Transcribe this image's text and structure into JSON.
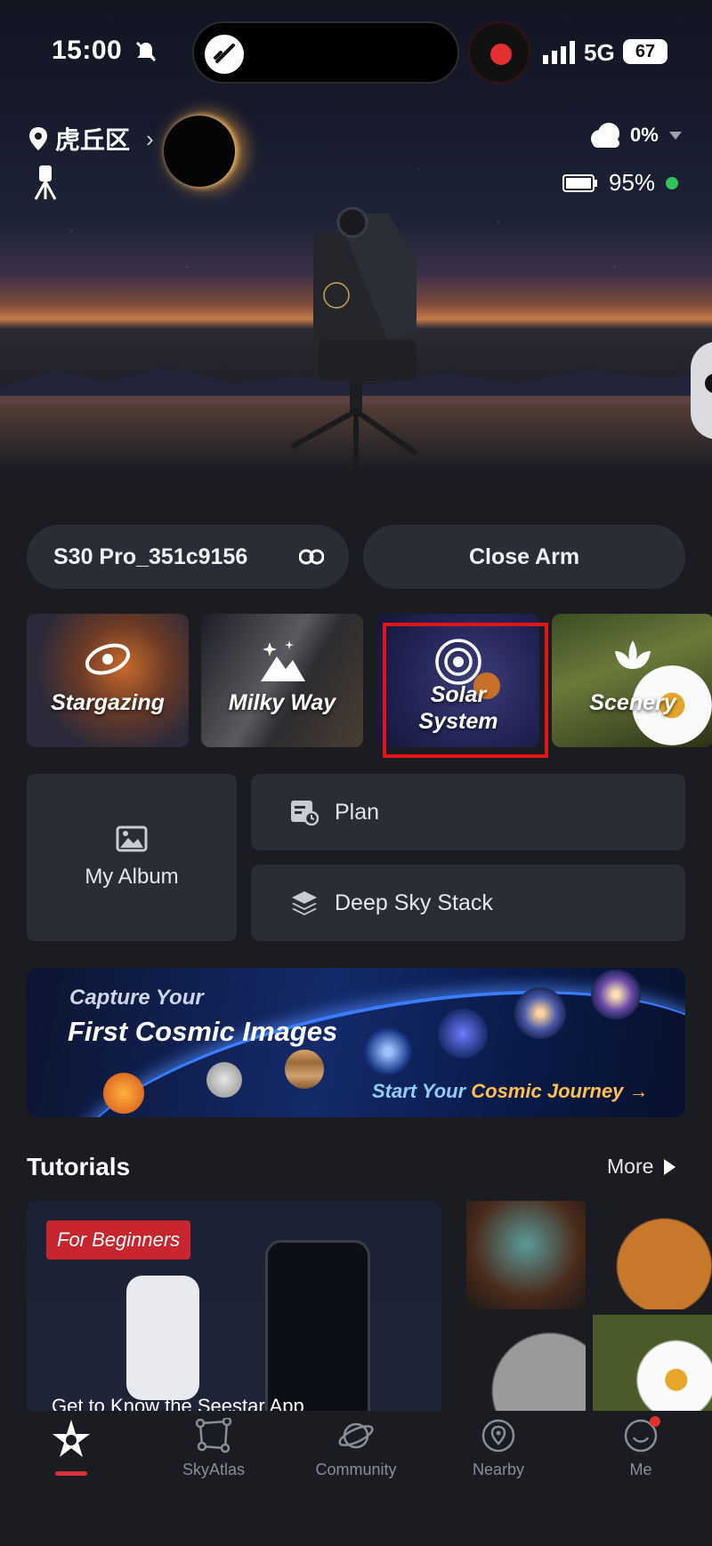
{
  "status_bar": {
    "time": "15:00",
    "network": "5G",
    "battery": "67"
  },
  "header": {
    "location": "虎丘区",
    "weather_value": "0%",
    "device_battery": "95%",
    "icons": [
      "location-pin-icon",
      "chevron-right-icon",
      "tripod-icon",
      "cloud-icon",
      "battery-icon"
    ]
  },
  "device": {
    "name": "S30 Pro_351c9156",
    "close_arm_label": "Close Arm"
  },
  "modes": [
    {
      "label": "Stargazing",
      "icon": "galaxy-icon"
    },
    {
      "label": "Milky Way",
      "icon": "mountain-stars-icon"
    },
    {
      "label_line1": "Solar",
      "label_line2": "System",
      "icon": "solar-system-icon",
      "highlighted": true
    },
    {
      "label": "Scenery",
      "icon": "lotus-icon"
    }
  ],
  "tools": {
    "album_label": "My Album",
    "plan_label": "Plan",
    "stack_label": "Deep Sky Stack"
  },
  "banner": {
    "line1": "Capture Your",
    "line2": "First Cosmic Images",
    "cta_part1": "Start Your ",
    "cta_part2": "Cosmic Journey",
    "cta_arrow": "→"
  },
  "tutorials": {
    "title": "Tutorials",
    "more_label": "More",
    "badge": "For Beginners",
    "card_caption": "Get to Know the Seestar App"
  },
  "nav": [
    {
      "label": "",
      "icon": "star-home-icon",
      "active": true
    },
    {
      "label": "SkyAtlas",
      "icon": "constellation-icon"
    },
    {
      "label": "Community",
      "icon": "planet-icon"
    },
    {
      "label": "Nearby",
      "icon": "location-icon"
    },
    {
      "label": "Me",
      "icon": "smile-icon"
    }
  ],
  "colors": {
    "background": "#1b1c22",
    "card": "#2a2d36",
    "accent_red": "#e01616",
    "online_green": "#32c45a"
  }
}
